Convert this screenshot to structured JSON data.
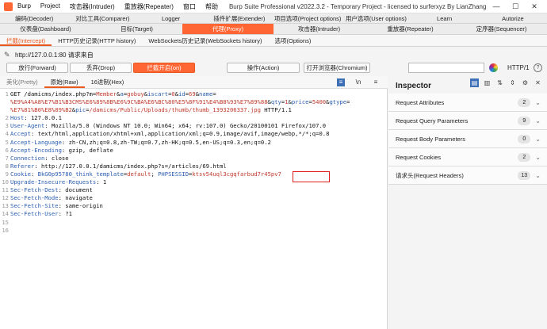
{
  "titlebar": {
    "menus": [
      "Burp",
      "Project",
      "攻击器(Intruder)",
      "重放器(Repeater)",
      "窗口",
      "帮助"
    ],
    "title": "Burp Suite Professional v2022.3.2 - Temporary Project - licensed to surferxyz By LianZhang.org By LianZhang...",
    "controls": [
      "—",
      "☐",
      "✕"
    ]
  },
  "tabs_row1": [
    "编码(Decoder)",
    "对比工具(Comparer)",
    "Logger",
    "插件扩展(Extender)",
    "项目选项(Project options)",
    "用户选项(User options)",
    "Learn",
    "Autorize"
  ],
  "tabs_row2": [
    "仪表盘(Dashboard)",
    "目标(Target)",
    "代理(Proxy)",
    "攻击器(Intruder)",
    "重放器(Repeater)",
    "定序器(Sequencer)"
  ],
  "active_tab_row2": "代理(Proxy)",
  "subtabs": [
    "拦截(Intercept)",
    "HTTP历史记录(HTTP history)",
    "WebSockets历史记录(WebSockets history)",
    "选项(Options)"
  ],
  "request_label": "http://127.0.0.1:80 请求来自",
  "toolbar": {
    "forward": "放行(Forward)",
    "drop": "丢弃(Drop)",
    "intercept": "拦截开启(on)",
    "action": "操作(Action)",
    "browser": "打开浏览器(Chromium)",
    "http_version": "HTTP/1",
    "help": "?"
  },
  "editor_tabs": [
    "美化(Pretty)",
    "原始(Raw)",
    "16进制(Hex)"
  ],
  "editor_icons": [
    "≡",
    "\\n",
    "≡"
  ],
  "code_lines": [
    {
      "n": "1",
      "segs": [
        {
          "t": "GET /damicms/index.php?m=",
          "c": ""
        },
        {
          "t": "Member",
          "c": "red"
        },
        {
          "t": "&",
          "c": ""
        },
        {
          "t": "a",
          "c": "key"
        },
        {
          "t": "=",
          "c": ""
        },
        {
          "t": "gobuy",
          "c": "red"
        },
        {
          "t": "&",
          "c": ""
        },
        {
          "t": "iscart",
          "c": "key"
        },
        {
          "t": "=",
          "c": ""
        },
        {
          "t": "0",
          "c": "red"
        },
        {
          "t": "&",
          "c": ""
        },
        {
          "t": "id",
          "c": "key"
        },
        {
          "t": "=",
          "c": ""
        },
        {
          "t": "69",
          "c": "red"
        },
        {
          "t": "&",
          "c": ""
        },
        {
          "t": "name",
          "c": "key"
        },
        {
          "t": "=",
          "c": ""
        }
      ]
    },
    {
      "n": "",
      "segs": [
        {
          "t": "%E9%A4%A8%E7%B1%B3CMS%E6%89%8B%E6%9C%BA%E6%BC%80%E5%8F%91%E4%B8%93%E7%89%88",
          "c": "red"
        },
        {
          "t": "&",
          "c": ""
        },
        {
          "t": "qty",
          "c": "key"
        },
        {
          "t": "=",
          "c": ""
        },
        {
          "t": "1",
          "c": "red"
        },
        {
          "t": "&",
          "c": ""
        },
        {
          "t": "price",
          "c": "key"
        },
        {
          "t": "=",
          "c": ""
        },
        {
          "t": "5400",
          "c": "red"
        },
        {
          "t": "&",
          "c": ""
        },
        {
          "t": "gtype",
          "c": "key"
        },
        {
          "t": "=",
          "c": ""
        }
      ]
    },
    {
      "n": "",
      "segs": [
        {
          "t": "%E7%81%B0%E8%89%B2",
          "c": "red"
        },
        {
          "t": "&",
          "c": ""
        },
        {
          "t": "pic",
          "c": "key"
        },
        {
          "t": "=",
          "c": ""
        },
        {
          "t": "/damicms/Public/Uploads/thumb/thumb_1393206337.jpg",
          "c": "red"
        },
        {
          "t": " HTTP/1.1",
          "c": ""
        }
      ]
    },
    {
      "n": "2",
      "segs": [
        {
          "t": "Host",
          "c": "blue"
        },
        {
          "t": ": 127.0.0.1",
          "c": ""
        }
      ]
    },
    {
      "n": "3",
      "segs": [
        {
          "t": "User-Agent",
          "c": "blue"
        },
        {
          "t": ": Mozilla/5.0 (Windows NT 10.0; Win64; x64; rv:107.0) Gecko/20100101 Firefox/107.0",
          "c": ""
        }
      ]
    },
    {
      "n": "4",
      "segs": [
        {
          "t": "Accept",
          "c": "blue"
        },
        {
          "t": ": text/html,application/xhtml+xml,application/xml;q=0.9,image/avif,image/webp,*/*;q=0.8",
          "c": ""
        }
      ]
    },
    {
      "n": "5",
      "segs": [
        {
          "t": "Accept-Language",
          "c": "blue"
        },
        {
          "t": ": zh-CN,zh;q=0.8,zh-TW;q=0.7,zh-HK;q=0.5,en-US;q=0.3,en;q=0.2",
          "c": ""
        }
      ]
    },
    {
      "n": "6",
      "segs": [
        {
          "t": "Accept-Encoding",
          "c": "blue"
        },
        {
          "t": ": gzip, deflate",
          "c": ""
        }
      ]
    },
    {
      "n": "7",
      "segs": [
        {
          "t": "Connection",
          "c": "blue"
        },
        {
          "t": ": close",
          "c": ""
        }
      ]
    },
    {
      "n": "8",
      "segs": [
        {
          "t": "Referer",
          "c": "blue"
        },
        {
          "t": ": http://127.0.0.1/damicms/index.php?s=/articles/69.html",
          "c": ""
        }
      ]
    },
    {
      "n": "9",
      "segs": [
        {
          "t": "Cookie",
          "c": "blue"
        },
        {
          "t": ": ",
          "c": ""
        },
        {
          "t": "BkG0p95780_think_template",
          "c": "blue"
        },
        {
          "t": "=",
          "c": ""
        },
        {
          "t": "default",
          "c": "red"
        },
        {
          "t": "; ",
          "c": ""
        },
        {
          "t": "PHPSESSID",
          "c": "blue"
        },
        {
          "t": "=",
          "c": ""
        },
        {
          "t": "ktsv54uql3cgqfarbud7r45pv7",
          "c": "red"
        }
      ]
    },
    {
      "n": "10",
      "segs": [
        {
          "t": "Upgrade-Insecure-Requests",
          "c": "blue"
        },
        {
          "t": ": 1",
          "c": ""
        }
      ]
    },
    {
      "n": "11",
      "segs": [
        {
          "t": "Sec-Fetch-Dest",
          "c": "blue"
        },
        {
          "t": ": document",
          "c": ""
        }
      ]
    },
    {
      "n": "12",
      "segs": [
        {
          "t": "Sec-Fetch-Mode",
          "c": "blue"
        },
        {
          "t": ": navigate",
          "c": ""
        }
      ]
    },
    {
      "n": "13",
      "segs": [
        {
          "t": "Sec-Fetch-Site",
          "c": "blue"
        },
        {
          "t": ": same-origin",
          "c": ""
        }
      ]
    },
    {
      "n": "14",
      "segs": [
        {
          "t": "Sec-Fetch-User",
          "c": "blue"
        },
        {
          "t": ": ?1",
          "c": ""
        }
      ]
    },
    {
      "n": "15",
      "segs": []
    },
    {
      "n": "16",
      "segs": []
    }
  ],
  "inspector": {
    "title": "Inspector",
    "icons": [
      "▤",
      "▥",
      "⇅",
      "⇕",
      "⚙",
      "✕"
    ],
    "rows": [
      {
        "label": "Request Attributes",
        "count": "2"
      },
      {
        "label": "Request Query Parameters",
        "count": "9"
      },
      {
        "label": "Request Body Parameters",
        "count": "0"
      },
      {
        "label": "Request Cookies",
        "count": "2"
      },
      {
        "label": "请求头(Request Headers)",
        "count": "13"
      }
    ]
  },
  "colors": {
    "accent": "#ff6633",
    "highlight_box": "#e01e1e"
  }
}
